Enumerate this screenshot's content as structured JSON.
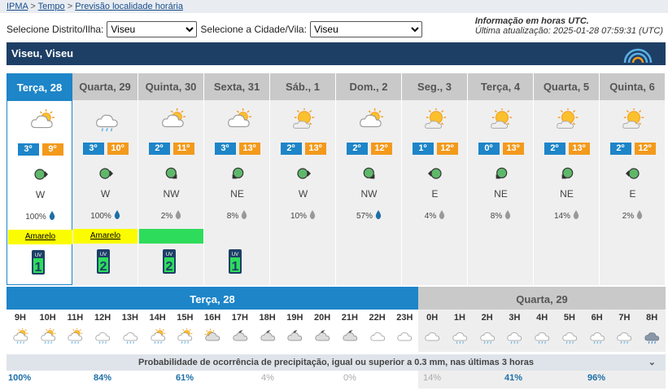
{
  "breadcrumb": [
    "IPMA",
    "Tempo",
    "Previsão localidade horária"
  ],
  "breadcrumb_sep": ">",
  "district_label": "Selecione Distrito/Ilha:",
  "district_value": "Viseu",
  "city_label": "Selecione a Cidade/Vila:",
  "city_value": "Viseu",
  "info_title": "Informação em horas UTC.",
  "last_update": "Última atualização: 2025-01-28 07:59:31 (UTC)",
  "location_title": "Viseu, Viseu",
  "colors": {
    "header": "#1d3f66",
    "accent": "#1d85c8",
    "min_temp": "#1d85c8",
    "max_temp": "#f39a1c",
    "warning_yellow": "#fcfc00",
    "warning_green": "#2edc5c"
  },
  "days": [
    {
      "label": "Terça, 28",
      "icon": "cloud-sun-icon",
      "tmin": "3º",
      "tmax": "9º",
      "wind_dir": "W",
      "wind_arrow": "arrow-east-icon",
      "prob": "100%",
      "drop": "blue",
      "warning": "Amarelo",
      "warning_color": "yellow",
      "uv": "1",
      "active": true
    },
    {
      "label": "Quarta, 29",
      "icon": "cloud-rain-icon",
      "tmin": "3º",
      "tmax": "10º",
      "wind_dir": "W",
      "wind_arrow": "arrow-east-icon",
      "prob": "100%",
      "drop": "blue",
      "warning": "Amarelo",
      "warning_color": "yellow",
      "uv": "2"
    },
    {
      "label": "Quinta, 30",
      "icon": "cloud-sun-icon",
      "tmin": "2º",
      "tmax": "11º",
      "wind_dir": "NW",
      "wind_arrow": "arrow-se-icon",
      "prob": "2%",
      "drop": "grey",
      "warning": "",
      "warning_color": "green",
      "uv": "2"
    },
    {
      "label": "Sexta, 31",
      "icon": "cloud-sun-icon",
      "tmin": "3º",
      "tmax": "13º",
      "wind_dir": "NE",
      "wind_arrow": "arrow-sw-icon",
      "prob": "8%",
      "drop": "grey",
      "warning": "",
      "warning_color": "none",
      "uv": "1"
    },
    {
      "label": "Sáb., 1",
      "icon": "sun-cloud-icon",
      "tmin": "2º",
      "tmax": "13º",
      "wind_dir": "W",
      "wind_arrow": "arrow-east-icon",
      "prob": "10%",
      "drop": "grey",
      "warning": "",
      "warning_color": "none",
      "uv": ""
    },
    {
      "label": "Dom., 2",
      "icon": "cloud-sun-icon",
      "tmin": "2º",
      "tmax": "12º",
      "wind_dir": "NW",
      "wind_arrow": "arrow-se-icon",
      "prob": "57%",
      "drop": "blue",
      "warning": "",
      "warning_color": "none",
      "uv": ""
    },
    {
      "label": "Seg., 3",
      "icon": "sun-cloud-icon",
      "tmin": "1º",
      "tmax": "12º",
      "wind_dir": "E",
      "wind_arrow": "arrow-west-icon",
      "prob": "4%",
      "drop": "grey",
      "warning": "",
      "warning_color": "none",
      "uv": ""
    },
    {
      "label": "Terça, 4",
      "icon": "sun-cloud-icon",
      "tmin": "0º",
      "tmax": "13º",
      "wind_dir": "NE",
      "wind_arrow": "arrow-sw-icon",
      "prob": "8%",
      "drop": "grey",
      "warning": "",
      "warning_color": "none",
      "uv": ""
    },
    {
      "label": "Quarta, 5",
      "icon": "sun-cloud-icon",
      "tmin": "2º",
      "tmax": "13º",
      "wind_dir": "NE",
      "wind_arrow": "arrow-sw-icon",
      "prob": "14%",
      "drop": "grey",
      "warning": "",
      "warning_color": "none",
      "uv": ""
    },
    {
      "label": "Quinta, 6",
      "icon": "sun-cloud-icon",
      "tmin": "2º",
      "tmax": "12º",
      "wind_dir": "E",
      "wind_arrow": "arrow-west-icon",
      "prob": "2%",
      "drop": "grey",
      "warning": "",
      "warning_color": "none",
      "uv": ""
    }
  ],
  "uv_label": "UV",
  "hourly_today_label": "Terça, 28",
  "hourly_next_label": "Quarta, 29",
  "hours": [
    {
      "h": "9H",
      "icon": "sun-cloud-rain-icon"
    },
    {
      "h": "10H",
      "icon": "sun-cloud-rain-icon"
    },
    {
      "h": "11H",
      "icon": "sun-cloud-rain-icon"
    },
    {
      "h": "12H",
      "icon": "cloud-rain-icon"
    },
    {
      "h": "13H",
      "icon": "cloud-rain-icon"
    },
    {
      "h": "14H",
      "icon": "sun-cloud-rain-icon"
    },
    {
      "h": "15H",
      "icon": "sun-cloud-rain-icon"
    },
    {
      "h": "16H",
      "icon": "sunset-cloud-icon"
    },
    {
      "h": "17H",
      "icon": "moon-cloud-icon"
    },
    {
      "h": "18H",
      "icon": "moon-cloud-icon"
    },
    {
      "h": "19H",
      "icon": "moon-cloud-icon"
    },
    {
      "h": "20H",
      "icon": "moon-cloud-icon"
    },
    {
      "h": "21H",
      "icon": "moon-cloud-icon"
    },
    {
      "h": "22H",
      "icon": "cloud-icon"
    },
    {
      "h": "23H",
      "icon": "cloud-icon"
    },
    {
      "h": "0H",
      "icon": "cloud-icon"
    },
    {
      "h": "1H",
      "icon": "cloud-rain-icon"
    },
    {
      "h": "2H",
      "icon": "cloud-rain-icon"
    },
    {
      "h": "3H",
      "icon": "cloud-rain-icon"
    },
    {
      "h": "4H",
      "icon": "cloud-rain-icon"
    },
    {
      "h": "5H",
      "icon": "cloud-rain-icon"
    },
    {
      "h": "6H",
      "icon": "cloud-rain-icon"
    },
    {
      "h": "7H",
      "icon": "cloud-rain-icon"
    },
    {
      "h": "8H",
      "icon": "heavy-rain-icon"
    }
  ],
  "prob_bar_label": "Probabilidade de ocorrência de precipitação, igual ou superior a 0.3 mm, nas últimas 3 horas",
  "prob_values": [
    {
      "v": "100%",
      "low": false
    },
    {
      "v": "84%",
      "low": false
    },
    {
      "v": "61%",
      "low": false
    },
    {
      "v": "4%",
      "low": true
    },
    {
      "v": "0%",
      "low": true
    },
    {
      "v": "14%",
      "low": true
    },
    {
      "v": "41%",
      "low": false
    },
    {
      "v": "96%",
      "low": false
    }
  ]
}
